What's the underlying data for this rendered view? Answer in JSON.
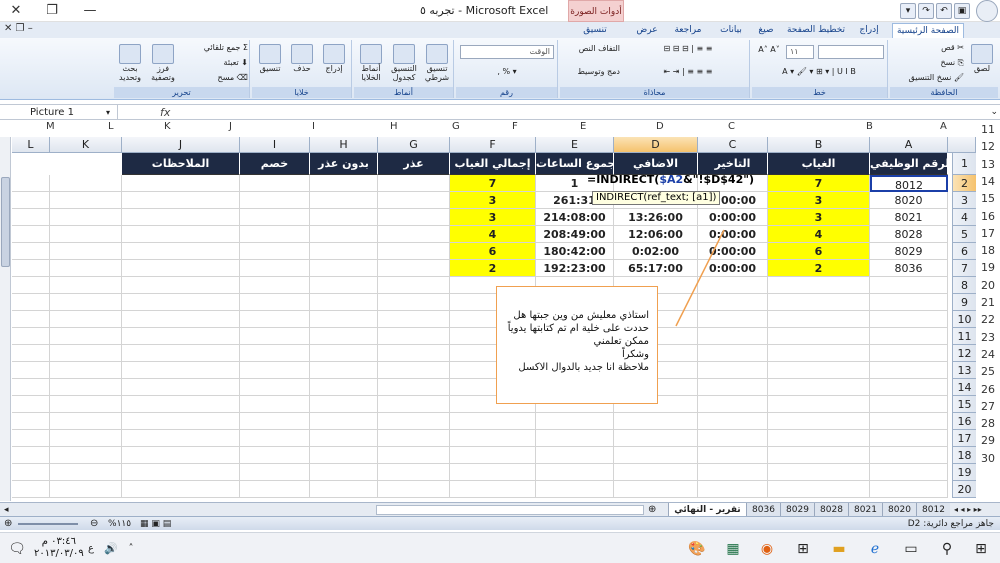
{
  "window": {
    "title": "Microsoft Excel - تجربه ٥",
    "context_tab": "أدوات الصورة"
  },
  "tabs": [
    "الصفحة الرئيسية",
    "إدراج",
    "تخطيط الصفحة",
    "صيغ",
    "بيانات",
    "مراجعة",
    "عرض",
    "تنسيق"
  ],
  "ribbon": {
    "clipboard": {
      "label": "الحافظة",
      "paste": "لصق",
      "cut": "قص",
      "copy": "نسخ",
      "format_painter": "نسخ التنسيق"
    },
    "font": {
      "label": "خط",
      "font_size": "١١"
    },
    "alignment": {
      "label": "محاذاة",
      "wrap": "التفاف النص",
      "merge": "دمج وتوسيط"
    },
    "number": {
      "label": "رقم",
      "format": "الوقت",
      "percent": "%"
    },
    "styles": {
      "label": "أنماط",
      "conditional": "تنسيق شرطي",
      "table": "التنسيق كجدول",
      "cell_styles": "أنماط الخلايا"
    },
    "cells": {
      "label": "خلايا",
      "insert": "إدراج",
      "delete": "حذف",
      "format": "تنسيق"
    },
    "editing": {
      "label": "تحرير",
      "autosum": "جمع تلقائي",
      "fill": "تعبئة",
      "clear": "مسح",
      "sort": "فرز وتصفية",
      "find": "بحث وتحديد"
    }
  },
  "formula_bar": {
    "name_box": "Picture 1",
    "fx": "fx"
  },
  "sheet": {
    "col_letters": [
      "A",
      "B",
      "C",
      "D",
      "E",
      "F",
      "G",
      "H",
      "I",
      "J",
      "K",
      "L",
      "M",
      "N"
    ],
    "col_headers": [
      "A",
      "B",
      "C",
      "D",
      "E",
      "F",
      "G",
      "H",
      "I",
      "J",
      "K",
      "L"
    ],
    "header_row": [
      "الرقم الوظيفي",
      "الغياب",
      "التاخير",
      "الاضافي",
      "مجموع الساعات",
      "إجمالي الغياب",
      "عذر",
      "بدون عذر",
      "خصم",
      "الملاحظات"
    ],
    "rows": [
      [
        "8012",
        "7",
        "",
        "",
        "1",
        "7"
      ],
      [
        "8020",
        "3",
        "0:00:00",
        "",
        "261:31",
        "3"
      ],
      [
        "8021",
        "3",
        "0:00:00",
        "13:26:00",
        "214:08:00",
        "3"
      ],
      [
        "8028",
        "4",
        "0:00:00",
        "12:06:00",
        "208:49:00",
        "4"
      ],
      [
        "8029",
        "6",
        "0:00:00",
        "0:02:00",
        "180:42:00",
        "6"
      ],
      [
        "8036",
        "2",
        "0:00:00",
        "65:17:00",
        "192:23:00",
        "2"
      ]
    ],
    "row_numbers": [
      "1",
      "2",
      "3",
      "4",
      "5",
      "6",
      "7",
      "8",
      "9",
      "10",
      "11",
      "12",
      "13",
      "14",
      "15",
      "16",
      "17",
      "18",
      "19",
      "20"
    ],
    "row_numbers_right": [
      "11",
      "12",
      "13",
      "14",
      "15",
      "16",
      "17",
      "18",
      "19",
      "20",
      "21",
      "22",
      "23",
      "24",
      "25",
      "26",
      "27",
      "28",
      "29",
      "30"
    ],
    "formula_prefix": "=INDIRECT(",
    "formula_ref": "$A2",
    "formula_suffix": "&\"!$D$42\")",
    "tooltip": "INDIRECT(ref_text; [a1])"
  },
  "callout": {
    "lines": [
      "استاذي معليش من وين جبتها هل",
      "حددت على خلية ام تم كتابتها يدوياً",
      "ممكن تعلمني",
      "وشكراً",
      "ملاحظة انا جديد بالدوال الاكسل"
    ]
  },
  "sheet_tabs": [
    "8012",
    "8020",
    "8021",
    "8028",
    "8029",
    "8036",
    "تقرير - النهائي"
  ],
  "status": {
    "left": "جاهز   مراجع دائرية: D2",
    "zoom": "%١١٥"
  },
  "taskbar": {
    "time": "٠٣:٤٦ م",
    "date": "٢٠١٣/٠٣/٠٩",
    "lang": "ع"
  }
}
